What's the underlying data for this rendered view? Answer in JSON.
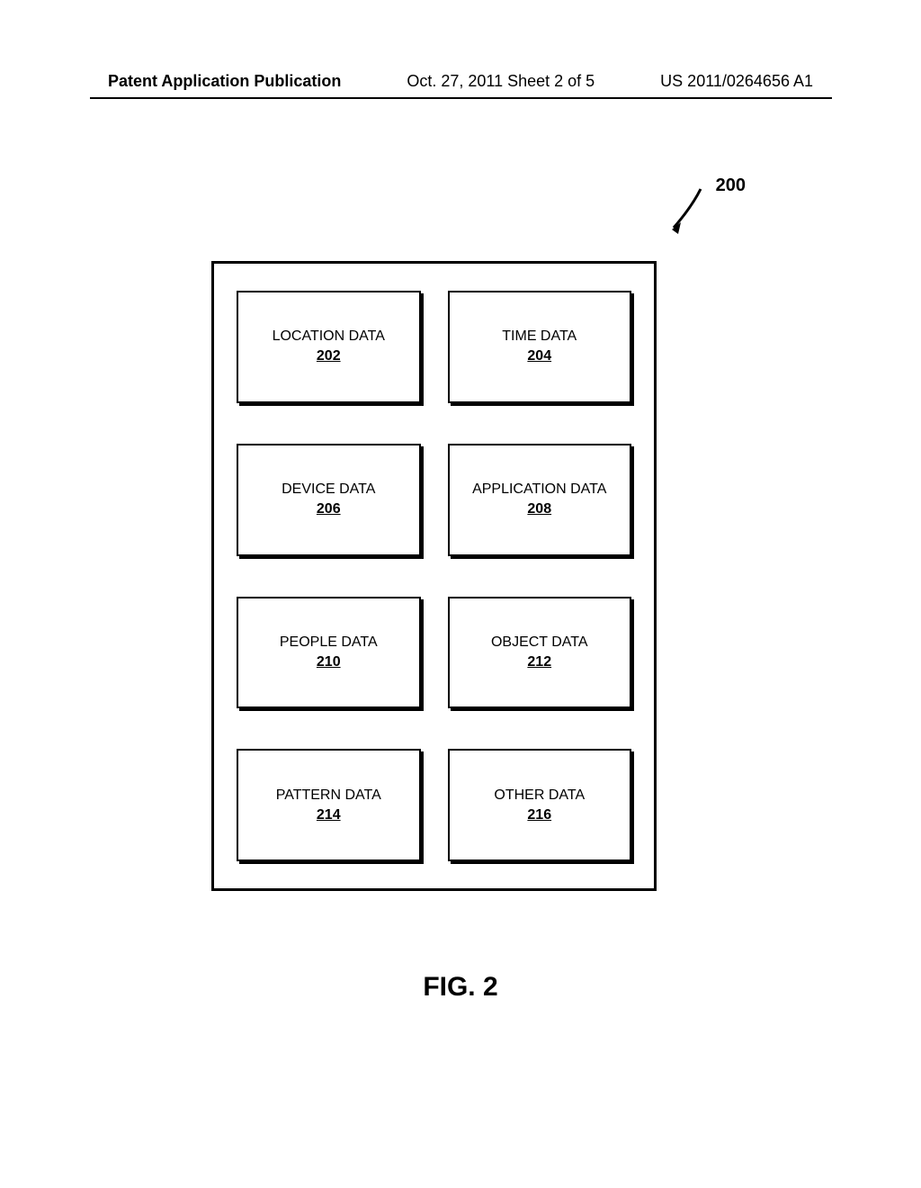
{
  "header": {
    "left": "Patent Application Publication",
    "center": "Oct. 27, 2011  Sheet 2 of 5",
    "right": "US 2011/0264656 A1"
  },
  "ref_number": "200",
  "boxes": [
    {
      "label": "LOCATION DATA",
      "num": "202"
    },
    {
      "label": "TIME DATA",
      "num": "204"
    },
    {
      "label": "DEVICE DATA",
      "num": "206"
    },
    {
      "label": "APPLICATION DATA",
      "num": "208"
    },
    {
      "label": "PEOPLE DATA",
      "num": "210"
    },
    {
      "label": "OBJECT DATA",
      "num": "212"
    },
    {
      "label": "PATTERN DATA",
      "num": "214"
    },
    {
      "label": "OTHER DATA",
      "num": "216"
    }
  ],
  "figure_label": "FIG. 2"
}
